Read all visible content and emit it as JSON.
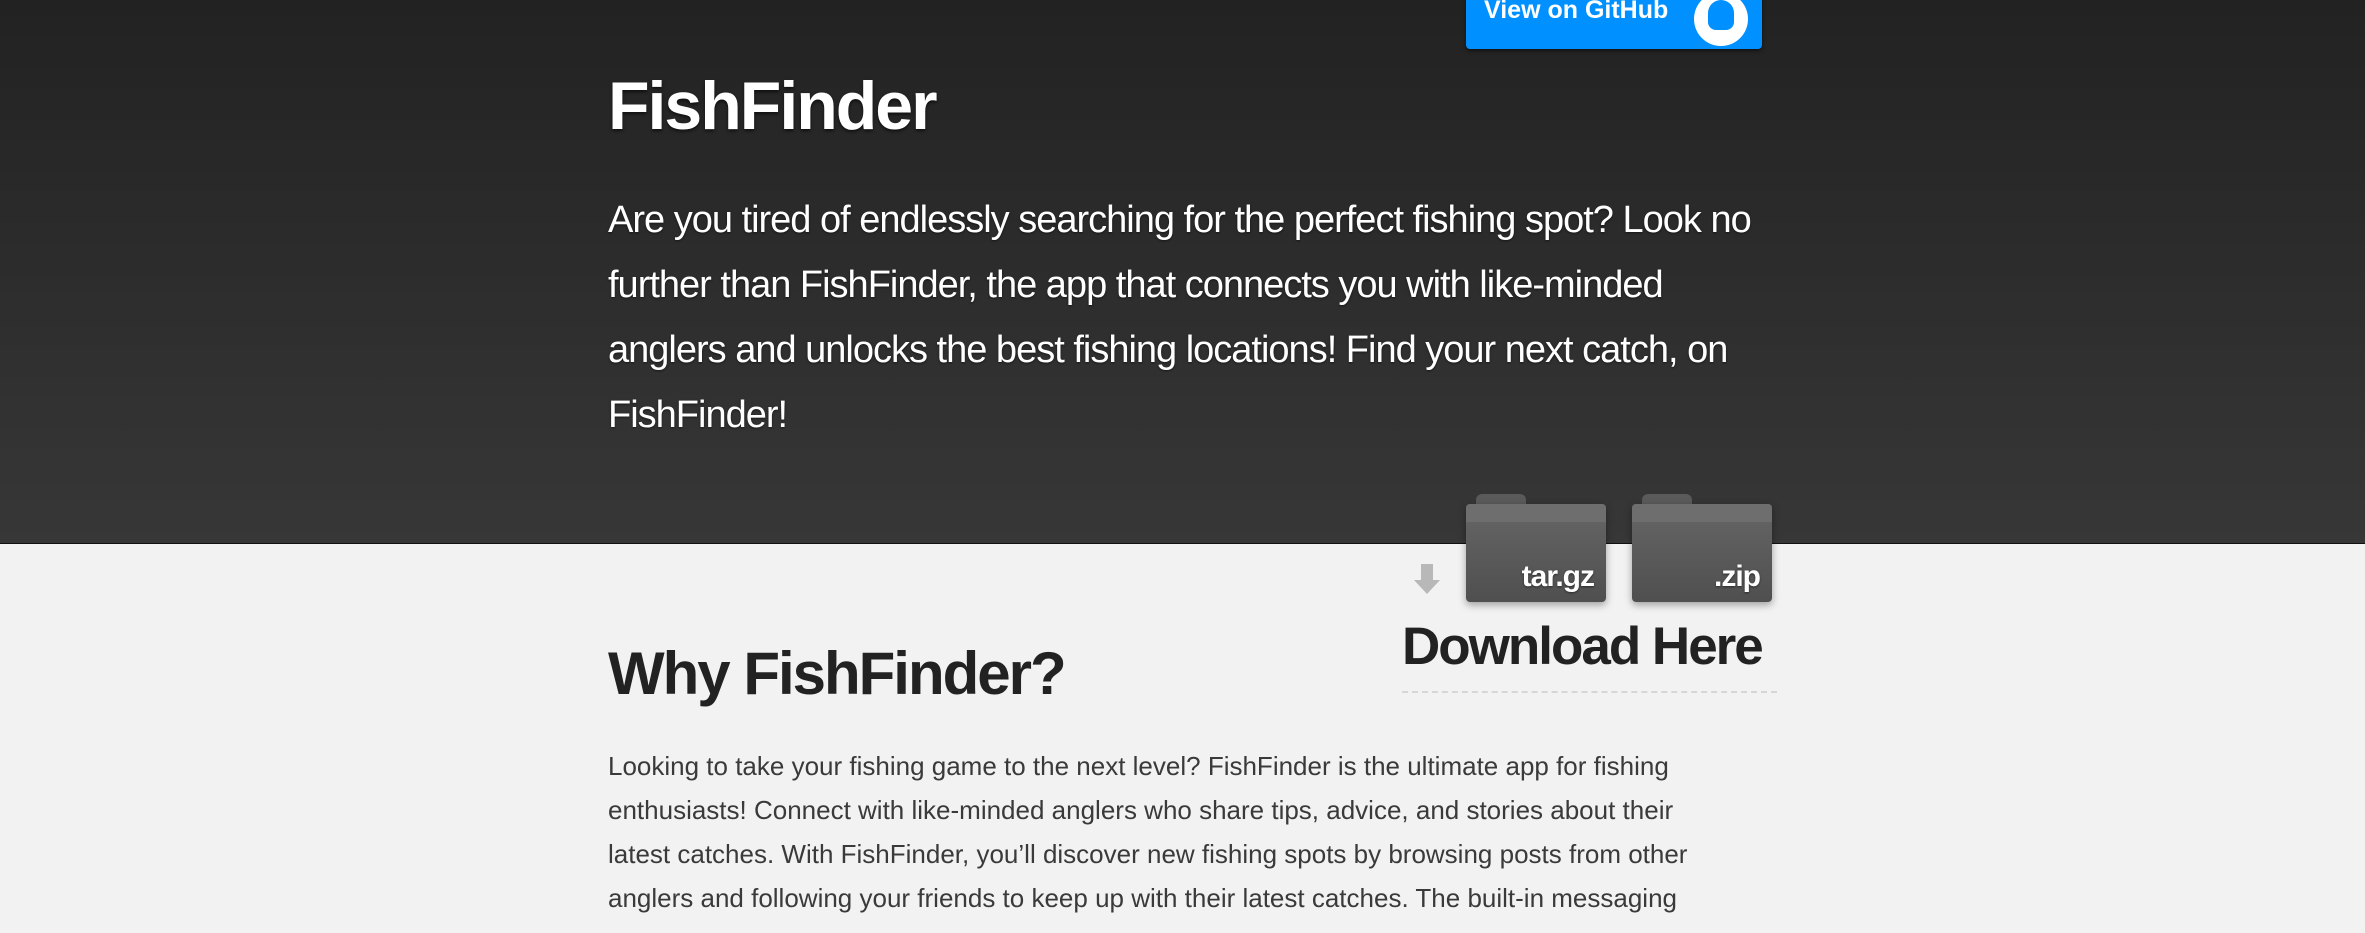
{
  "header": {
    "github_button_label": "View on GitHub",
    "title": "FishFinder",
    "tagline": "Are you tired of endlessly searching for the perfect fishing spot? Look no further than FishFinder, the app that connects you with like-minded anglers and unlocks the best fishing locations! Find your next catch, on FishFinder!"
  },
  "downloads": {
    "tar_label": "tar.gz",
    "zip_label": ".zip",
    "heading": "Download Here"
  },
  "main": {
    "heading": "Why FishFinder?",
    "paragraph": "Looking to take your fishing game to the next level? FishFinder is the ultimate app for fishing enthusiasts! Connect with like-minded anglers who share tips, advice, and stories about their latest catches. With FishFinder, you’ll discover new fishing spots by browsing posts from other anglers and following your friends to keep up with their latest catches. The built-in messaging"
  },
  "colors": {
    "header_bg": "#2b2b2b",
    "main_bg": "#f2f2f2",
    "github_button": "#0090ff"
  }
}
